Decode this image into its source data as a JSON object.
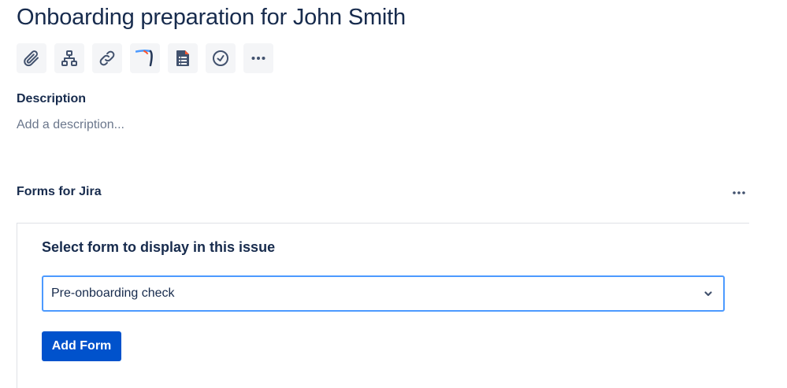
{
  "issue": {
    "title": "Onboarding preparation for John Smith"
  },
  "toolbar": {
    "buttons": [
      {
        "icon": "paperclip-icon",
        "action": "attach"
      },
      {
        "icon": "hierarchy-icon",
        "action": "child-issue"
      },
      {
        "icon": "link-icon",
        "action": "link-issue"
      },
      {
        "icon": "boomerang-icon",
        "action": "app"
      },
      {
        "icon": "form-document-icon",
        "action": "forms"
      },
      {
        "icon": "clock-icon",
        "action": "log-time"
      },
      {
        "icon": "more-icon",
        "action": "more"
      }
    ]
  },
  "description": {
    "label": "Description",
    "placeholder": "Add a description..."
  },
  "forms": {
    "section_label": "Forms for Jira",
    "panel_title": "Select form to display in this issue",
    "selected_form": "Pre-onboarding check",
    "add_button_label": "Add Form"
  },
  "colors": {
    "text_primary": "#172B4D",
    "text_subtle": "#6B778C",
    "button_primary": "#0052CC",
    "focus_border": "#4C9AFF",
    "toolbar_bg": "#F4F5F7"
  }
}
